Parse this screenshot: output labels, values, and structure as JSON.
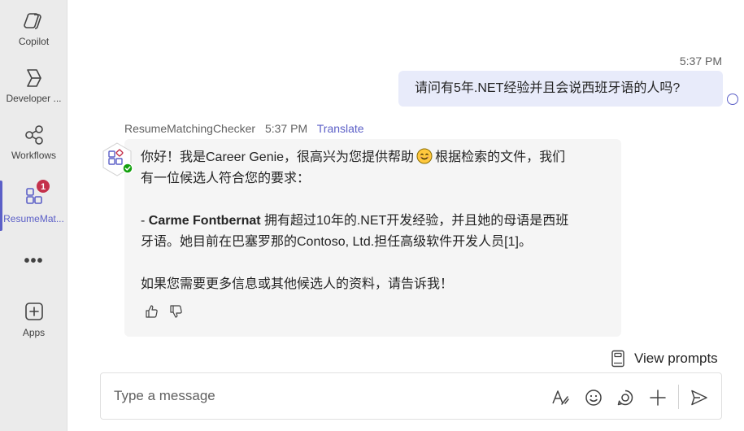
{
  "rail": {
    "items": [
      {
        "label": "Copilot",
        "icon": "copilot-icon"
      },
      {
        "label": "Developer ...",
        "icon": "developer-portal-icon"
      },
      {
        "label": "Workflows",
        "icon": "workflows-icon"
      },
      {
        "label": "ResumeMat...",
        "icon": "app-grid-icon",
        "badge": "1",
        "active": true
      },
      {
        "label": "Apps",
        "icon": "add-apps-icon"
      }
    ],
    "more": "•••"
  },
  "chat": {
    "user_message": {
      "time": "5:37 PM",
      "text": "请问有5年.NET经验并且会说西班牙语的人吗?"
    },
    "bot_message": {
      "sender": "ResumeMatchingChecker",
      "time": "5:37 PM",
      "translate": "Translate",
      "line1a": "你好！我是Career Genie，很高兴为您提供帮助",
      "line1b": "根据检索的文件，我们",
      "line2": "有一位候选人符合您的要求：",
      "candidate_prefix": "- ",
      "candidate_name": "Carme Fontbernat",
      "candidate_detail1": " 拥有超过10年的.NET开发经验，并且她的母语是西班",
      "candidate_detail2": "牙语。她目前在巴塞罗那的Contoso, Ltd.担任高级软件开发人员[1]。",
      "closing": "如果您需要更多信息或其他候选人的资料，请告诉我！"
    }
  },
  "view_prompts": "View prompts",
  "composer": {
    "placeholder": "Type a message"
  },
  "colors": {
    "accent": "#5b5fc7",
    "badge": "#c4314b",
    "user_bubble": "#e8ebfa",
    "bot_bubble": "#f5f5f5"
  }
}
